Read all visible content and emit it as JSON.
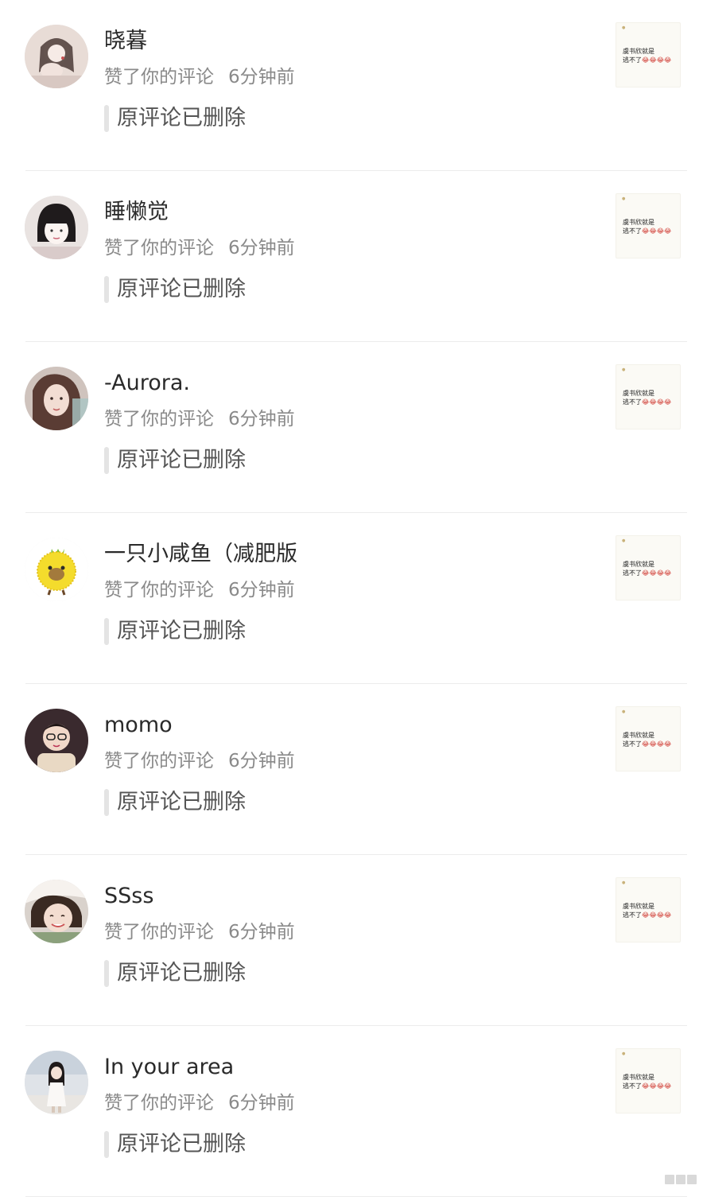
{
  "notifications": [
    {
      "name": "晓暮",
      "action": "赞了你的评论",
      "time": "6分钟前",
      "quote": "原评论已删除",
      "avatar_icon": "avatar-girl-hand-icon"
    },
    {
      "name": "睡懒觉",
      "action": "赞了你的评论",
      "time": "6分钟前",
      "quote": "原评论已删除",
      "avatar_icon": "avatar-bob-hair-icon"
    },
    {
      "name": "-Aurora.",
      "action": "赞了你的评论",
      "time": "6分钟前",
      "quote": "原评论已删除",
      "avatar_icon": "avatar-selfie-icon"
    },
    {
      "name": "一只小咸鱼（减肥版",
      "action": "赞了你的评论",
      "time": "6分钟前",
      "quote": "原评论已删除",
      "avatar_icon": "avatar-yellow-chick-icon"
    },
    {
      "name": "momo",
      "action": "赞了你的评论",
      "time": "6分钟前",
      "quote": "原评论已删除",
      "avatar_icon": "avatar-baby-icon"
    },
    {
      "name": "SSss",
      "action": "赞了你的评论",
      "time": "6分钟前",
      "quote": "原评论已删除",
      "avatar_icon": "avatar-smiling-girl-icon"
    },
    {
      "name": "In your area",
      "action": "赞了你的评论",
      "time": "6分钟前",
      "quote": "原评论已删除",
      "avatar_icon": "avatar-standing-girl-icon"
    }
  ],
  "thumbnail": {
    "line1": "虞书欣就是",
    "line2": "逃不了",
    "emoji": "😂😂😂😂"
  },
  "colors": {
    "name": "#2a2a2a",
    "meta": "#8a8a8a",
    "quote_text": "#555555",
    "quote_bar": "#e4e4e4",
    "divider": "#ececec",
    "thumb_bg": "#fbfaf5"
  }
}
